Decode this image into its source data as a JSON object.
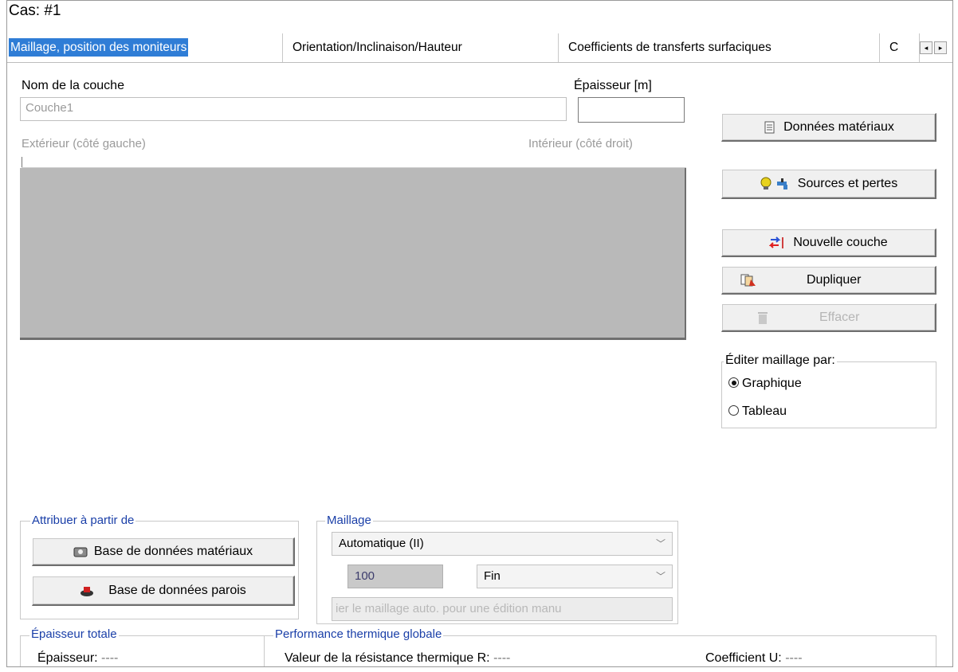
{
  "case_title": "Cas:  #1",
  "tabs": [
    {
      "label": "Maillage, position des moniteurs",
      "active": true
    },
    {
      "label": "Orientation/Inclinaison/Hauteur",
      "active": false
    },
    {
      "label": "Coefficients de transferts surfaciques",
      "active": false
    },
    {
      "label": "C",
      "active": false
    }
  ],
  "layer": {
    "name_label": "Nom de la couche",
    "name_value": "Couche1",
    "thickness_label": "Épaisseur [m]",
    "thickness_value": "",
    "left_side_label": "Extérieur (côté gauche)",
    "right_side_label": "Intérieur (côté droit)"
  },
  "buttons": {
    "material_data": "Données matériaux",
    "sources_losses": "Sources et pertes",
    "new_layer": "Nouvelle couche",
    "duplicate": "Dupliquer",
    "delete": "Effacer"
  },
  "edit_mesh": {
    "title": "Éditer maillage par:",
    "options": [
      "Graphique",
      "Tableau"
    ],
    "selected": "Graphique"
  },
  "assign_from": {
    "title": "Attribuer à partir de",
    "material_db": "Base de données matériaux",
    "wall_db": "Base de données parois"
  },
  "mesh": {
    "title": "Maillage",
    "mode": "Automatique (II)",
    "count": "100",
    "fineness": "Fin",
    "manual_note": "ier le maillage auto. pour une édition manu"
  },
  "total_thickness": {
    "title": "Épaisseur totale",
    "label": "Épaisseur:",
    "value": "----"
  },
  "thermal_performance": {
    "title": "Performance thermique globale",
    "r_label": "Valeur de la résistance thermique R:",
    "r_value": "----",
    "u_label": "Coefficient U:",
    "u_value": "----"
  },
  "colors": {
    "active_tab": "#2f7dd6",
    "group_title": "#1a3fa8",
    "layer_panel": "#b9b9b9"
  }
}
